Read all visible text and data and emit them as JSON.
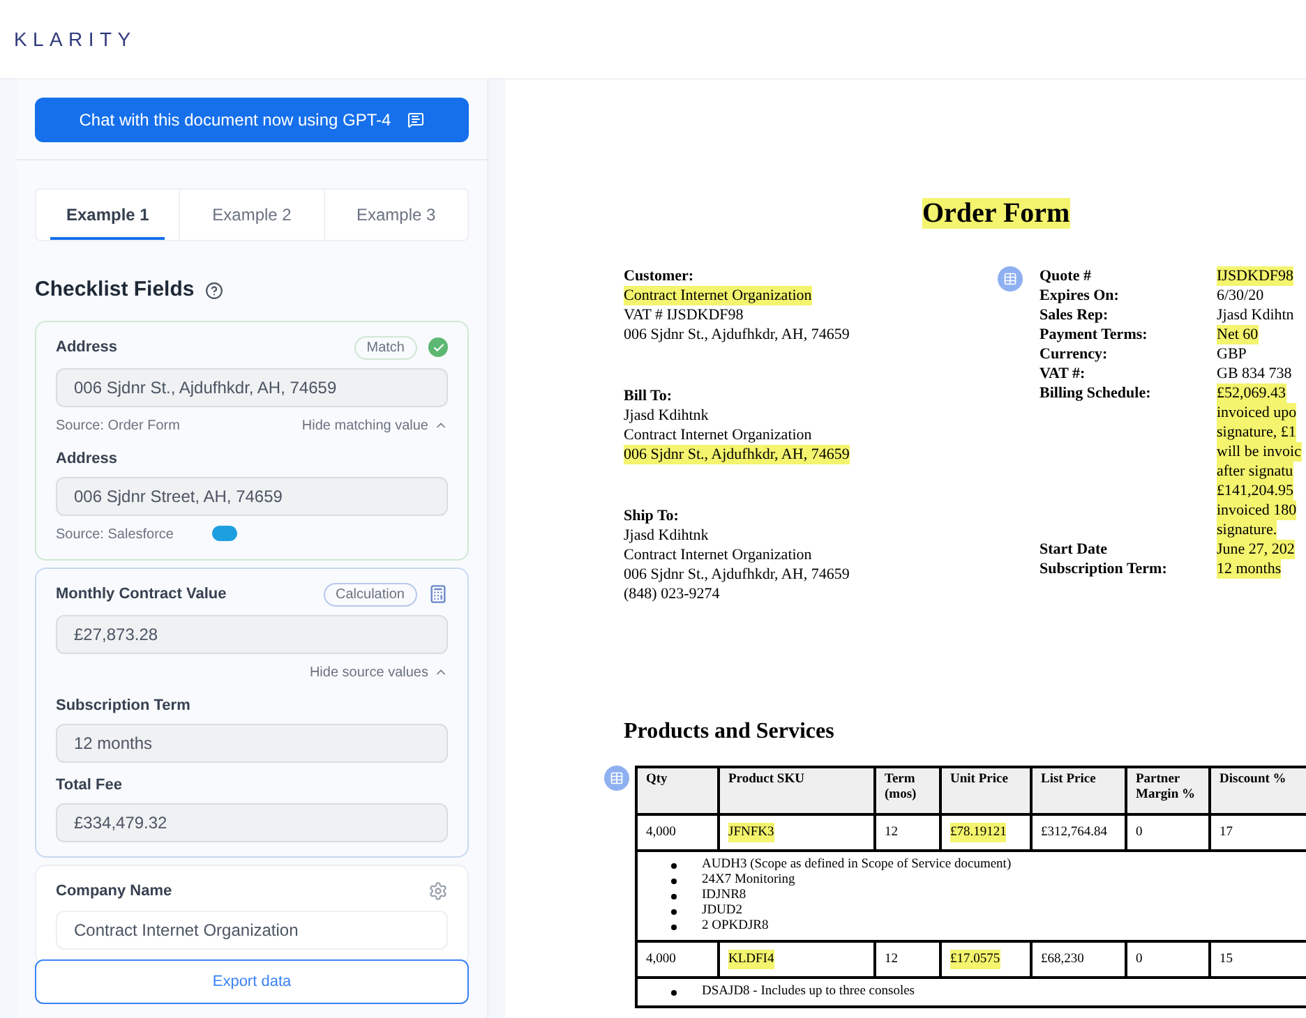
{
  "header": {
    "logo": "KLARITY"
  },
  "chat_button": {
    "label": "Chat with this document now using GPT-4"
  },
  "tabs": [
    {
      "label": "Example 1",
      "selected": true
    },
    {
      "label": "Example 2",
      "selected": false
    },
    {
      "label": "Example 3",
      "selected": false
    }
  ],
  "checklist": {
    "title": "Checklist Fields",
    "cards": [
      {
        "kind": "match",
        "label": "Address",
        "badge": "Match",
        "value": "006 Sjdnr St., Ajdufhkdr, AH, 74659",
        "source": "Source: Order Form",
        "toggle": "Hide matching value",
        "sub_fields": [
          {
            "label": "Address",
            "value": "006 Sjdnr Street, AH, 74659",
            "source": "Source: Salesforce"
          }
        ]
      },
      {
        "kind": "calculation",
        "label": "Monthly Contract Value",
        "badge": "Calculation",
        "value": "£27,873.28",
        "toggle": "Hide source values",
        "sub_fields": [
          {
            "label": "Subscription Term",
            "value": "12 months"
          },
          {
            "label": "Total Fee",
            "value": "£334,479.32"
          }
        ]
      },
      {
        "kind": "plain",
        "label": "Company Name",
        "value": "Contract Internet Organization"
      }
    ]
  },
  "export_button": {
    "label": "Export data"
  },
  "document": {
    "title": "Order Form",
    "left_blocks": [
      {
        "heading": "Customer:",
        "lines": [
          {
            "text": "Contract Internet Organization",
            "highlighted": true
          },
          {
            "text": "VAT # IJSDKDF98",
            "highlighted": false
          },
          {
            "text": "006 Sjdnr St., Ajdufhkdr, AH, 74659",
            "highlighted": false
          }
        ]
      },
      {
        "heading": "Bill To:",
        "lines": [
          {
            "text": "Jjasd Kdihtnk",
            "highlighted": false
          },
          {
            "text": "Contract Internet Organization",
            "highlighted": false
          },
          {
            "text": "006 Sjdnr St., Ajdufhkdr, AH, 74659",
            "highlighted": true
          }
        ]
      },
      {
        "heading": "Ship To:",
        "lines": [
          {
            "text": "Jjasd Kdihtnk",
            "highlighted": false
          },
          {
            "text": "Contract Internet Organization",
            "highlighted": false
          },
          {
            "text": "006 Sjdnr St., Ajdufhkdr, AH, 74659",
            "highlighted": false
          },
          {
            "text": "(848) 023-9274",
            "highlighted": false
          }
        ]
      }
    ],
    "right_rows": [
      {
        "label": "Quote #",
        "highlighted": true,
        "lines": [
          "IJSDKDF98"
        ]
      },
      {
        "label": "Expires On:",
        "highlighted": false,
        "lines": [
          "6/30/20"
        ]
      },
      {
        "label": "Sales Rep:",
        "highlighted": false,
        "lines": [
          "Jjasd Kdihtn"
        ]
      },
      {
        "label": "Payment Terms:",
        "highlighted": true,
        "lines": [
          "Net 60"
        ]
      },
      {
        "label": "Currency:",
        "highlighted": false,
        "lines": [
          "GBP"
        ]
      },
      {
        "label": "VAT #:",
        "highlighted": false,
        "lines": [
          "GB 834 738"
        ]
      },
      {
        "label": "Billing Schedule:",
        "highlighted": true,
        "lines": [
          "£52,069.43",
          "invoiced upo",
          "signature, £1",
          "will be invoic",
          "after signatu",
          "£141,204.95",
          "invoiced 180",
          "signature."
        ]
      },
      {
        "label": "Start Date",
        "highlighted": true,
        "lines": [
          "June 27, 202"
        ]
      },
      {
        "label": "Subscription Term:",
        "highlighted": true,
        "lines": [
          "12 months"
        ]
      }
    ],
    "products_title": "Products and Services",
    "table": {
      "columns": [
        "Qty",
        "Product SKU",
        "Term (mos)",
        "Unit Price",
        "List Price",
        "Partner Margin %",
        "Discount %"
      ],
      "rows": [
        {
          "kind": "item",
          "cells": [
            {
              "text": "4,000",
              "highlighted": false
            },
            {
              "text": "JFNFK3",
              "highlighted": true
            },
            {
              "text": "12",
              "highlighted": false
            },
            {
              "text": "£78.19121",
              "highlighted": true
            },
            {
              "text": "£312,764.84",
              "highlighted": false
            },
            {
              "text": "0",
              "highlighted": false
            },
            {
              "text": "17",
              "highlighted": false
            }
          ]
        },
        {
          "kind": "notes",
          "bullets": [
            "AUDH3 (Scope as defined in Scope of Service document)",
            "24X7 Monitoring",
            "IDJNR8",
            "JDUD2",
            "2 OPKDJR8"
          ]
        },
        {
          "kind": "item",
          "cells": [
            {
              "text": "4,000",
              "highlighted": false
            },
            {
              "text": "KLDFI4",
              "highlighted": true
            },
            {
              "text": "12",
              "highlighted": false
            },
            {
              "text": "£17.0575",
              "highlighted": true
            },
            {
              "text": "£68,230",
              "highlighted": false
            },
            {
              "text": "0",
              "highlighted": false
            },
            {
              "text": "15",
              "highlighted": false
            }
          ]
        },
        {
          "kind": "notes",
          "bullets": [
            "DSAJD8 - Includes up to three consoles"
          ]
        }
      ]
    }
  }
}
